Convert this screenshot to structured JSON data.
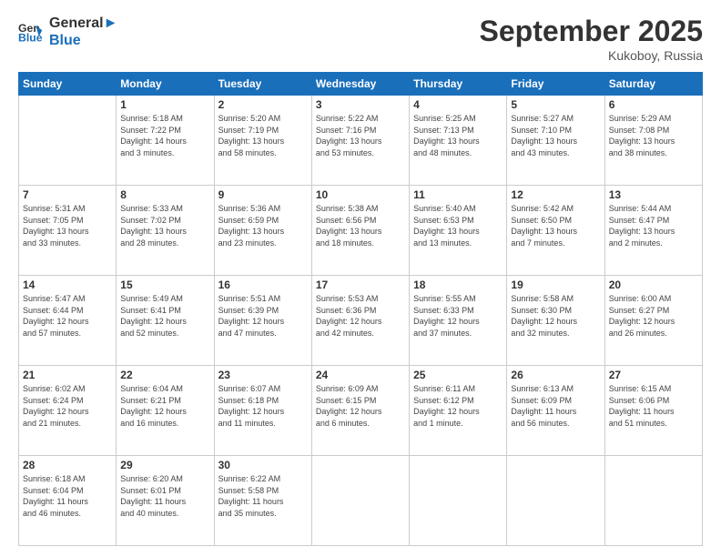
{
  "header": {
    "logo_line1": "General",
    "logo_line2": "Blue",
    "month": "September 2025",
    "location": "Kukoboy, Russia"
  },
  "weekdays": [
    "Sunday",
    "Monday",
    "Tuesday",
    "Wednesday",
    "Thursday",
    "Friday",
    "Saturday"
  ],
  "weeks": [
    [
      {
        "day": "",
        "info": ""
      },
      {
        "day": "1",
        "info": "Sunrise: 5:18 AM\nSunset: 7:22 PM\nDaylight: 14 hours\nand 3 minutes."
      },
      {
        "day": "2",
        "info": "Sunrise: 5:20 AM\nSunset: 7:19 PM\nDaylight: 13 hours\nand 58 minutes."
      },
      {
        "day": "3",
        "info": "Sunrise: 5:22 AM\nSunset: 7:16 PM\nDaylight: 13 hours\nand 53 minutes."
      },
      {
        "day": "4",
        "info": "Sunrise: 5:25 AM\nSunset: 7:13 PM\nDaylight: 13 hours\nand 48 minutes."
      },
      {
        "day": "5",
        "info": "Sunrise: 5:27 AM\nSunset: 7:10 PM\nDaylight: 13 hours\nand 43 minutes."
      },
      {
        "day": "6",
        "info": "Sunrise: 5:29 AM\nSunset: 7:08 PM\nDaylight: 13 hours\nand 38 minutes."
      }
    ],
    [
      {
        "day": "7",
        "info": "Sunrise: 5:31 AM\nSunset: 7:05 PM\nDaylight: 13 hours\nand 33 minutes."
      },
      {
        "day": "8",
        "info": "Sunrise: 5:33 AM\nSunset: 7:02 PM\nDaylight: 13 hours\nand 28 minutes."
      },
      {
        "day": "9",
        "info": "Sunrise: 5:36 AM\nSunset: 6:59 PM\nDaylight: 13 hours\nand 23 minutes."
      },
      {
        "day": "10",
        "info": "Sunrise: 5:38 AM\nSunset: 6:56 PM\nDaylight: 13 hours\nand 18 minutes."
      },
      {
        "day": "11",
        "info": "Sunrise: 5:40 AM\nSunset: 6:53 PM\nDaylight: 13 hours\nand 13 minutes."
      },
      {
        "day": "12",
        "info": "Sunrise: 5:42 AM\nSunset: 6:50 PM\nDaylight: 13 hours\nand 7 minutes."
      },
      {
        "day": "13",
        "info": "Sunrise: 5:44 AM\nSunset: 6:47 PM\nDaylight: 13 hours\nand 2 minutes."
      }
    ],
    [
      {
        "day": "14",
        "info": "Sunrise: 5:47 AM\nSunset: 6:44 PM\nDaylight: 12 hours\nand 57 minutes."
      },
      {
        "day": "15",
        "info": "Sunrise: 5:49 AM\nSunset: 6:41 PM\nDaylight: 12 hours\nand 52 minutes."
      },
      {
        "day": "16",
        "info": "Sunrise: 5:51 AM\nSunset: 6:39 PM\nDaylight: 12 hours\nand 47 minutes."
      },
      {
        "day": "17",
        "info": "Sunrise: 5:53 AM\nSunset: 6:36 PM\nDaylight: 12 hours\nand 42 minutes."
      },
      {
        "day": "18",
        "info": "Sunrise: 5:55 AM\nSunset: 6:33 PM\nDaylight: 12 hours\nand 37 minutes."
      },
      {
        "day": "19",
        "info": "Sunrise: 5:58 AM\nSunset: 6:30 PM\nDaylight: 12 hours\nand 32 minutes."
      },
      {
        "day": "20",
        "info": "Sunrise: 6:00 AM\nSunset: 6:27 PM\nDaylight: 12 hours\nand 26 minutes."
      }
    ],
    [
      {
        "day": "21",
        "info": "Sunrise: 6:02 AM\nSunset: 6:24 PM\nDaylight: 12 hours\nand 21 minutes."
      },
      {
        "day": "22",
        "info": "Sunrise: 6:04 AM\nSunset: 6:21 PM\nDaylight: 12 hours\nand 16 minutes."
      },
      {
        "day": "23",
        "info": "Sunrise: 6:07 AM\nSunset: 6:18 PM\nDaylight: 12 hours\nand 11 minutes."
      },
      {
        "day": "24",
        "info": "Sunrise: 6:09 AM\nSunset: 6:15 PM\nDaylight: 12 hours\nand 6 minutes."
      },
      {
        "day": "25",
        "info": "Sunrise: 6:11 AM\nSunset: 6:12 PM\nDaylight: 12 hours\nand 1 minute."
      },
      {
        "day": "26",
        "info": "Sunrise: 6:13 AM\nSunset: 6:09 PM\nDaylight: 11 hours\nand 56 minutes."
      },
      {
        "day": "27",
        "info": "Sunrise: 6:15 AM\nSunset: 6:06 PM\nDaylight: 11 hours\nand 51 minutes."
      }
    ],
    [
      {
        "day": "28",
        "info": "Sunrise: 6:18 AM\nSunset: 6:04 PM\nDaylight: 11 hours\nand 46 minutes."
      },
      {
        "day": "29",
        "info": "Sunrise: 6:20 AM\nSunset: 6:01 PM\nDaylight: 11 hours\nand 40 minutes."
      },
      {
        "day": "30",
        "info": "Sunrise: 6:22 AM\nSunset: 5:58 PM\nDaylight: 11 hours\nand 35 minutes."
      },
      {
        "day": "",
        "info": ""
      },
      {
        "day": "",
        "info": ""
      },
      {
        "day": "",
        "info": ""
      },
      {
        "day": "",
        "info": ""
      }
    ]
  ]
}
